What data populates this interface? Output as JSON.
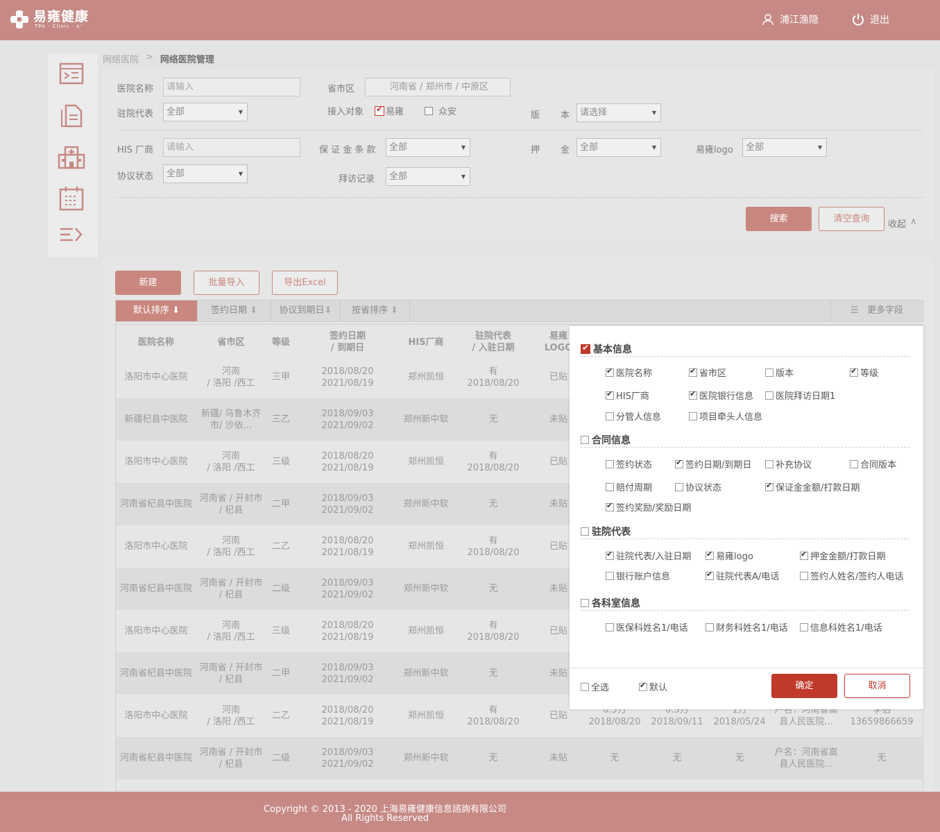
{
  "header": {
    "logo_main": "易雍健康",
    "logo_sub": "TPA · Clinic · e⁺",
    "user_name": "浦江渔隐",
    "logout_label": "退出"
  },
  "sidebar": {
    "items": [
      {
        "icon": "claims-icon"
      },
      {
        "icon": "documents-icon"
      },
      {
        "icon": "hospital-icon"
      },
      {
        "icon": "calendar-list-icon"
      },
      {
        "icon": "menu-expand-icon"
      }
    ]
  },
  "breadcrumb": {
    "parent": "网络医院",
    "separator": ">",
    "current": "网络医院管理"
  },
  "filters": {
    "hospital_name_label": "医院名称",
    "hospital_name_placeholder": "请输入",
    "region_label": "省市区",
    "region_value": "河南省 / 郑州市 / 中原区",
    "rep_label": "驻院代表",
    "rep_value": "全部",
    "access_label": "接入对象",
    "access_opt1": "易雍",
    "access_opt2": "众安",
    "version_label_a": "版",
    "version_label_b": "本",
    "version_value": "请选择",
    "his_label": "HIS 厂商",
    "his_placeholder": "请输入",
    "guarantee_label": "保 证 金 条 款",
    "guarantee_value": "全部",
    "deposit_label_a": "押",
    "deposit_label_b": "金",
    "deposit_value": "全部",
    "logo_label": "易雍logo",
    "logo_value": "全部",
    "agreement_label": "协议状态",
    "agreement_value": "全部",
    "visit_label": "拜访记录",
    "visit_value": "全部",
    "search_button": "搜索",
    "clear_button": "清空查询",
    "collapse_label": "收起"
  },
  "actions": {
    "new": "新建",
    "batch_import": "批量导入",
    "export": "导出Excel"
  },
  "sortbar": {
    "default": "默认排序",
    "sign_date": "签约日期",
    "expire_date": "协议到期日",
    "province": "按省排序",
    "more_fields": "更多字段"
  },
  "table": {
    "headers": [
      "医院名称",
      "省市区",
      "等级",
      "签约日期\n/ 到期日",
      "HIS厂商",
      "驻院代表\n/ 入驻日期",
      "易雍\nLOGO"
    ],
    "rows": [
      {
        "name": "洛阳市中心医院",
        "region": "河南\n/ 洛阳 /西工",
        "level": "三甲",
        "dates": "2018/08/20\n2021/08/19",
        "his": "郑州凯恒",
        "rep": "有\n2018/08/20",
        "logo": "已贴"
      },
      {
        "name": "新疆杞县中医院",
        "region": "新疆/ 乌鲁木齐\n市/ 沙依...",
        "level": "三乙",
        "dates": "2018/09/03\n2021/09/02",
        "his": "郑州新中软",
        "rep": "无",
        "logo": "未贴"
      },
      {
        "name": "洛阳市中心医院",
        "region": "河南\n/ 洛阳 /西工",
        "level": "三级",
        "dates": "2018/08/20\n2021/08/19",
        "his": "郑州凯恒",
        "rep": "有\n2018/08/20",
        "logo": "已贴"
      },
      {
        "name": "河南省杞县中医院",
        "region": "河南省 / 开封市\n/ 杞县",
        "level": "二甲",
        "dates": "2018/09/03\n2021/09/02",
        "his": "郑州新中软",
        "rep": "无",
        "logo": "未贴"
      },
      {
        "name": "洛阳市中心医院",
        "region": "河南\n/ 洛阳 /西工",
        "level": "二乙",
        "dates": "2018/08/20\n2021/08/19",
        "his": "郑州凯恒",
        "rep": "有\n2018/08/20",
        "logo": "已贴"
      },
      {
        "name": "河南省杞县中医院",
        "region": "河南省 / 开封市\n/ 杞县",
        "level": "二级",
        "dates": "2018/09/03\n2021/09/02",
        "his": "郑州新中软",
        "rep": "无",
        "logo": "未贴"
      },
      {
        "name": "洛阳市中心医院",
        "region": "河南\n/ 洛阳 /西工",
        "level": "三级",
        "dates": "2018/08/20\n2021/08/19",
        "his": "郑州凯恒",
        "rep": "有\n2018/08/20",
        "logo": "已贴"
      },
      {
        "name": "河南省杞县中医院",
        "region": "河南省 / 开封市\n/ 杞县",
        "level": "二甲",
        "dates": "2018/09/03\n2021/09/02",
        "his": "郑州新中软",
        "rep": "无",
        "logo": "未贴"
      },
      {
        "name": "洛阳市中心医院",
        "region": "河南\n/ 洛阳 /西工",
        "level": "二乙",
        "dates": "2018/08/20\n2021/08/19",
        "his": "郑州凯恒",
        "rep": "有\n2018/08/20",
        "logo": "已贴",
        "c8": "0.5万\n2018/08/20",
        "c9": "0.5万\n2018/09/11",
        "c10": "1万\n2018/05/24",
        "c11": "户名：河南省嵩\n县人民医院...",
        "c12": "李铝\n13659866659"
      },
      {
        "name": "河南省杞县中医院",
        "region": "河南省 / 开封市\n/ 杞县",
        "level": "二级",
        "dates": "2018/09/03\n2021/09/02",
        "his": "郑州新中软",
        "rep": "无",
        "logo": "未贴",
        "c8": "无",
        "c9": "无",
        "c10": "无",
        "c11": "户名：河南省嵩\n县人民医院...",
        "c12": "无"
      }
    ]
  },
  "modal": {
    "sections": [
      {
        "title": "基本信息",
        "checked": true,
        "options": [
          {
            "label": "医院名称",
            "checked": true
          },
          {
            "label": "省市区",
            "checked": true
          },
          {
            "label": "版本",
            "checked": false
          },
          {
            "label": "等级",
            "checked": true
          },
          {
            "label": "HIS厂商",
            "checked": true
          },
          {
            "label": "医院银行信息",
            "checked": true
          },
          {
            "label": "医院拜访日期1",
            "checked": false
          },
          {
            "label": "分管人信息",
            "checked": false
          },
          {
            "label": "项目牵头人信息",
            "checked": false
          }
        ]
      },
      {
        "title": "合同信息",
        "checked": false,
        "options": [
          {
            "label": "签约状态",
            "checked": false
          },
          {
            "label": "签约日期/到期日",
            "checked": true
          },
          {
            "label": "补充协议",
            "checked": false
          },
          {
            "label": "合同版本",
            "checked": false
          },
          {
            "label": "赔付周期",
            "checked": false
          },
          {
            "label": "协议状态",
            "checked": false
          },
          {
            "label": "保证金金额/打款日期",
            "checked": true
          },
          {
            "label": "签约奖励/奖励日期",
            "checked": true
          }
        ]
      },
      {
        "title": "驻院代表",
        "checked": false,
        "options": [
          {
            "label": "驻院代表/入驻日期",
            "checked": true
          },
          {
            "label": "易雍logo",
            "checked": true
          },
          {
            "label": "押金金额/打款日期",
            "checked": true
          },
          {
            "label": "银行账户信息",
            "checked": false
          },
          {
            "label": "驻院代表A/电话",
            "checked": true
          },
          {
            "label": "签约人姓名/签约人电话",
            "checked": false
          }
        ]
      },
      {
        "title": "各科室信息",
        "checked": false,
        "options": [
          {
            "label": "医保科姓名1/电话",
            "checked": false
          },
          {
            "label": "财务科姓名1/电话",
            "checked": false
          },
          {
            "label": "信息科姓名1/电话",
            "checked": false
          }
        ]
      }
    ],
    "select_all": "全选",
    "default": "默认",
    "confirm": "确定",
    "cancel": "取消",
    "accent": "#c0392b"
  },
  "footer": {
    "line1": "Copyright © 2013 - 2020 上海易雍健康信息諮詢有限公司",
    "line2": "All Rights Reserved"
  },
  "colors": {
    "brand": "#c68985",
    "button": "#c9877f",
    "modal_accent": "#c0392b"
  }
}
